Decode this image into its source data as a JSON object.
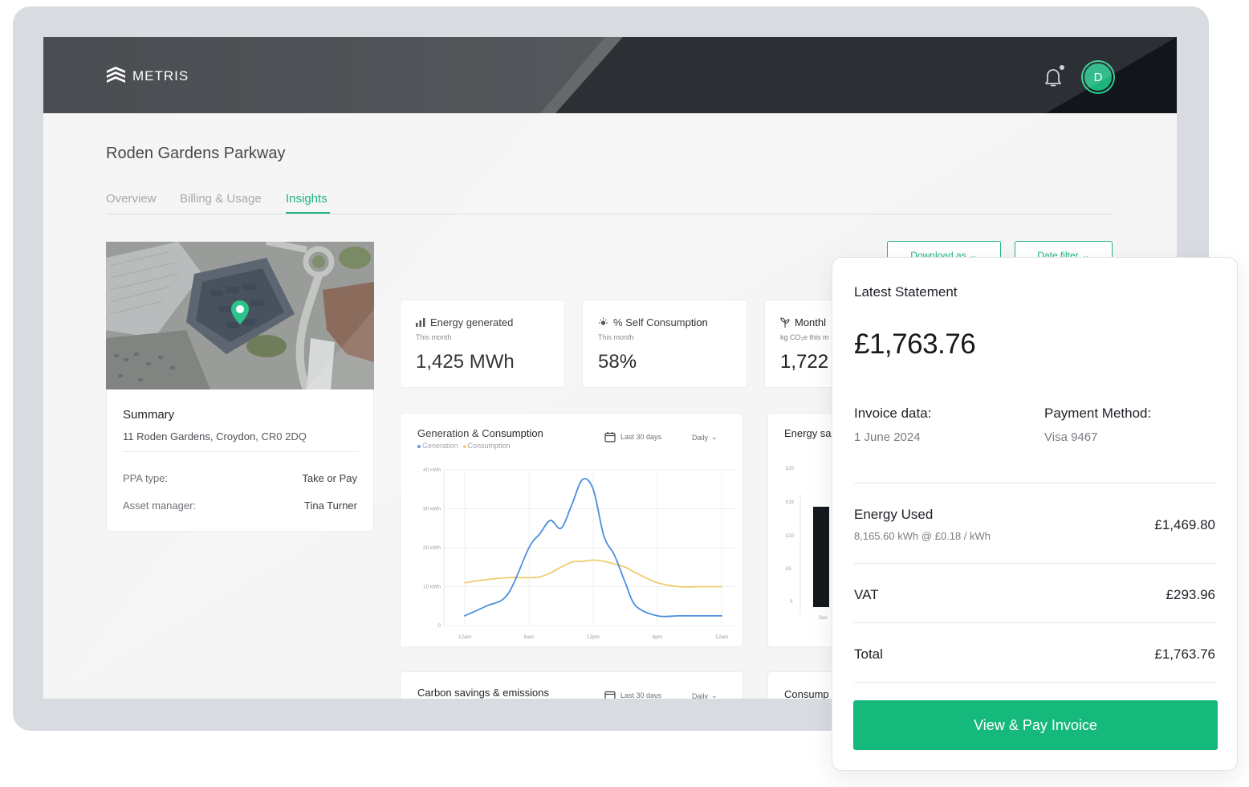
{
  "app": {
    "brand": "METRIS",
    "avatar_initial": "D"
  },
  "page": {
    "title": "Roden Gardens Parkway"
  },
  "tabs": [
    {
      "label": "Overview",
      "active": false
    },
    {
      "label": "Billing & Usage",
      "active": false
    },
    {
      "label": "Insights",
      "active": true
    }
  ],
  "toolbar": {
    "download_label": "Download as",
    "date_filter_label": "Date filter"
  },
  "summary": {
    "title": "Summary",
    "address": "11 Roden Gardens, Croydon, CR0 2DQ",
    "ppa_label": "PPA type:",
    "ppa_value": "Take or Pay",
    "manager_label": "Asset manager:",
    "manager_value": "Tina Turner"
  },
  "stats": [
    {
      "title": "Energy generated",
      "sub": "This month",
      "value": "1,425 MWh",
      "icon": "bar-chart-icon"
    },
    {
      "title": "% Self Consumption",
      "sub": "This month",
      "value": "58%",
      "icon": "sun-icon"
    },
    {
      "title": "Monthl",
      "sub": "kg CO₂e this m",
      "value": "1,722",
      "icon": "plant-icon"
    }
  ],
  "generation_chart": {
    "title": "Generation & Consumption",
    "legend": [
      "Generation",
      "Consumption"
    ],
    "period": "Last 30 days",
    "granularity": "Daily",
    "colors": {
      "generation": "#4a8fe0",
      "consumption": "#f0cc6e"
    }
  },
  "chart_data": {
    "type": "line",
    "xlabel": "",
    "ylabel": "",
    "y_ticks": [
      "40 kWh",
      "30 kWh",
      "20 kWh",
      "10 kWh",
      "0"
    ],
    "x_ticks": [
      "12am",
      "6am",
      "12pm",
      "6pm",
      "12am"
    ],
    "ylim": [
      0,
      40
    ],
    "x": [
      0,
      2,
      4,
      6,
      7,
      8,
      9,
      10,
      11,
      12,
      13,
      14,
      15,
      16,
      18,
      20,
      22,
      24
    ],
    "series": [
      {
        "name": "Generation",
        "values": [
          2.5,
          5,
          8,
          20,
          23.5,
          27,
          25,
          31,
          37.5,
          35,
          23,
          18,
          11,
          5,
          2.5,
          2.5,
          2.5,
          2.5
        ]
      },
      {
        "name": "Consumption",
        "values": [
          11,
          11.8,
          12.3,
          12.3,
          12.5,
          13.5,
          15,
          16.3,
          16.5,
          16.8,
          16.5,
          15.8,
          15,
          13.5,
          11,
          10,
          10,
          10
        ]
      }
    ]
  },
  "energy_savings": {
    "title": "Energy sa",
    "y_ticks": [
      "£20",
      "£15",
      "£10",
      "£5",
      "0"
    ],
    "x_tick": "Sun"
  },
  "carbon": {
    "title": "Carbon savings & emissions",
    "period": "Last 30 days",
    "granularity": "Daily"
  },
  "consumption": {
    "title": "Consump"
  },
  "statement": {
    "title": "Latest Statement",
    "amount": "£1,763.76",
    "invoice_label": "Invoice data:",
    "invoice_value": "1 June 2024",
    "payment_label": "Payment Method:",
    "payment_value": "Visa 9467",
    "energy_label": "Energy Used",
    "energy_sub": "8,165.60 kWh @ £0.18 / kWh",
    "energy_value": "£1,469.80",
    "vat_label": "VAT",
    "vat_value": "£293.96",
    "total_label": "Total",
    "total_value": "£1,763.76",
    "pay_button": "View & Pay Invoice"
  }
}
